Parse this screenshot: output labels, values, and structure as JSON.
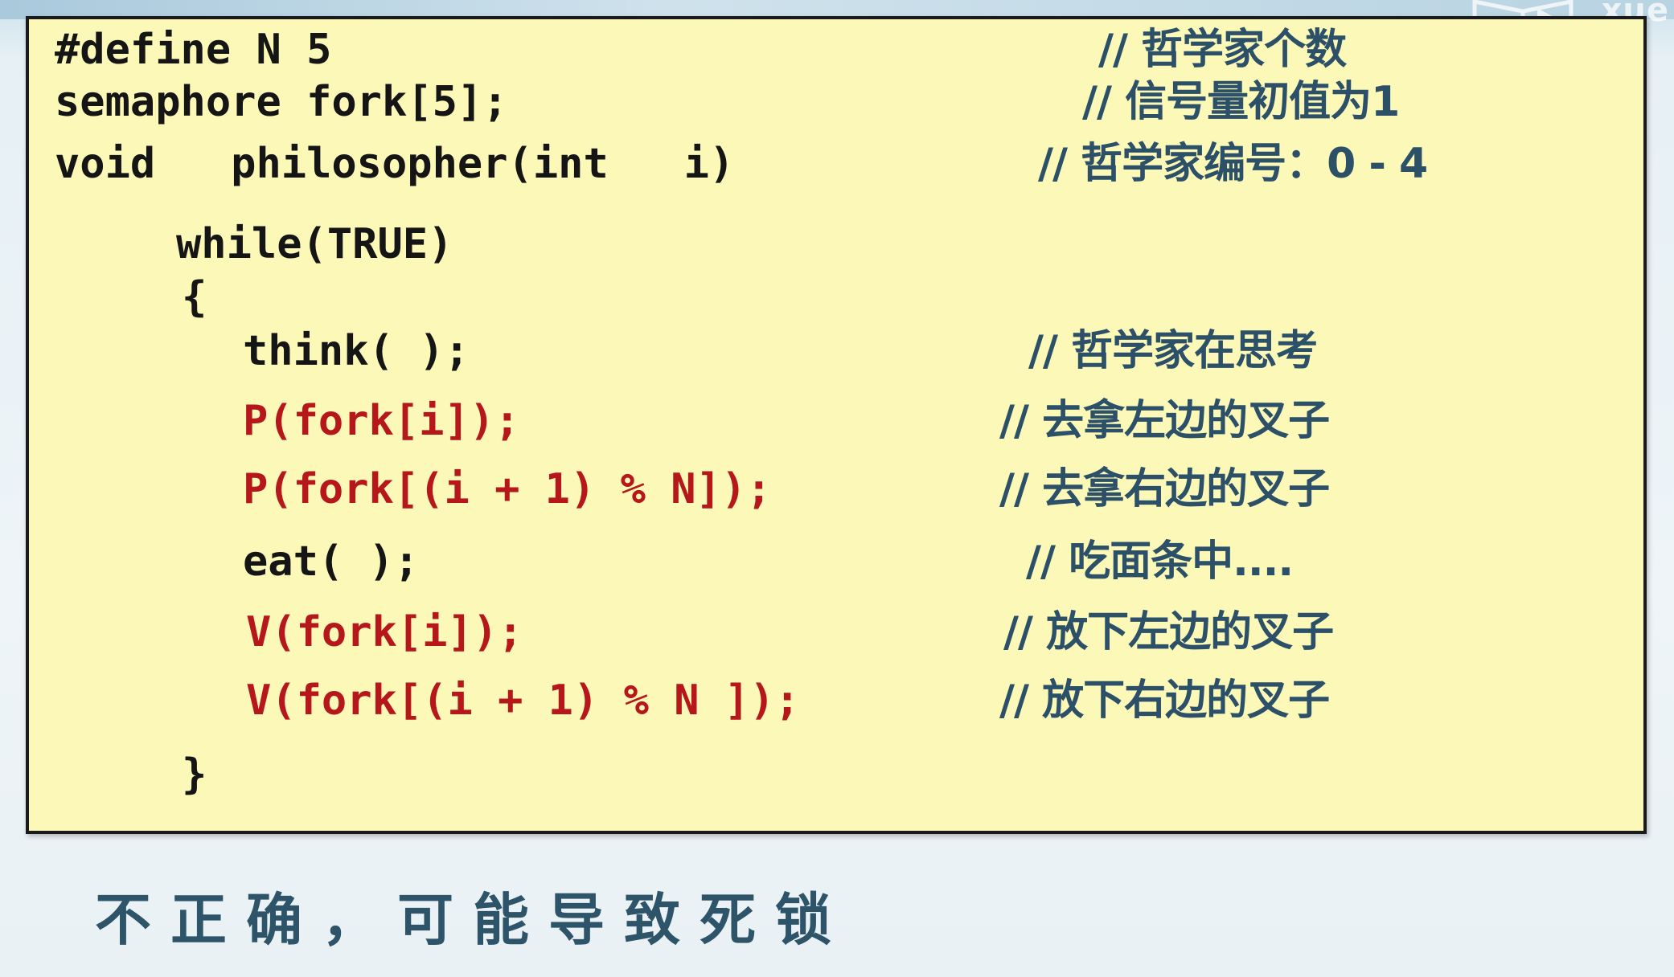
{
  "watermark": {
    "icon": "book-logo-icon",
    "text": "xue"
  },
  "code": {
    "line1": {
      "code": "#define N 5",
      "comment": "// 哲学家个数"
    },
    "line2": {
      "code": "semaphore fork[5];",
      "comment": "// 信号量初值为1"
    },
    "line3": {
      "code": "void   philosopher(int   i)",
      "comment": "// 哲学家编号：0 - 4"
    },
    "line4": {
      "code": "while(TRUE)"
    },
    "line5": {
      "code": "{"
    },
    "line6": {
      "code": "think( );",
      "comment": "// 哲学家在思考"
    },
    "line7": {
      "code": "P(fork[i]);",
      "comment": "// 去拿左边的叉子"
    },
    "line8": {
      "code": "P(fork[(i + 1) % N]);",
      "comment": "// 去拿右边的叉子"
    },
    "line9": {
      "code": "eat( );",
      "comment": "// 吃面条中...."
    },
    "line10": {
      "code": "V(fork[i]);",
      "comment": "// 放下左边的叉子"
    },
    "line11": {
      "code": "V(fork[(i + 1) % N ]);",
      "comment": "// 放下右边的叉子"
    },
    "line12": {
      "code": "}"
    }
  },
  "conclusion": "不正确，可能导致死锁",
  "colors": {
    "box_background": "#fcf8b8",
    "code_black": "#151515",
    "code_red": "#b5171b",
    "comment_blue": "#2b5068"
  }
}
